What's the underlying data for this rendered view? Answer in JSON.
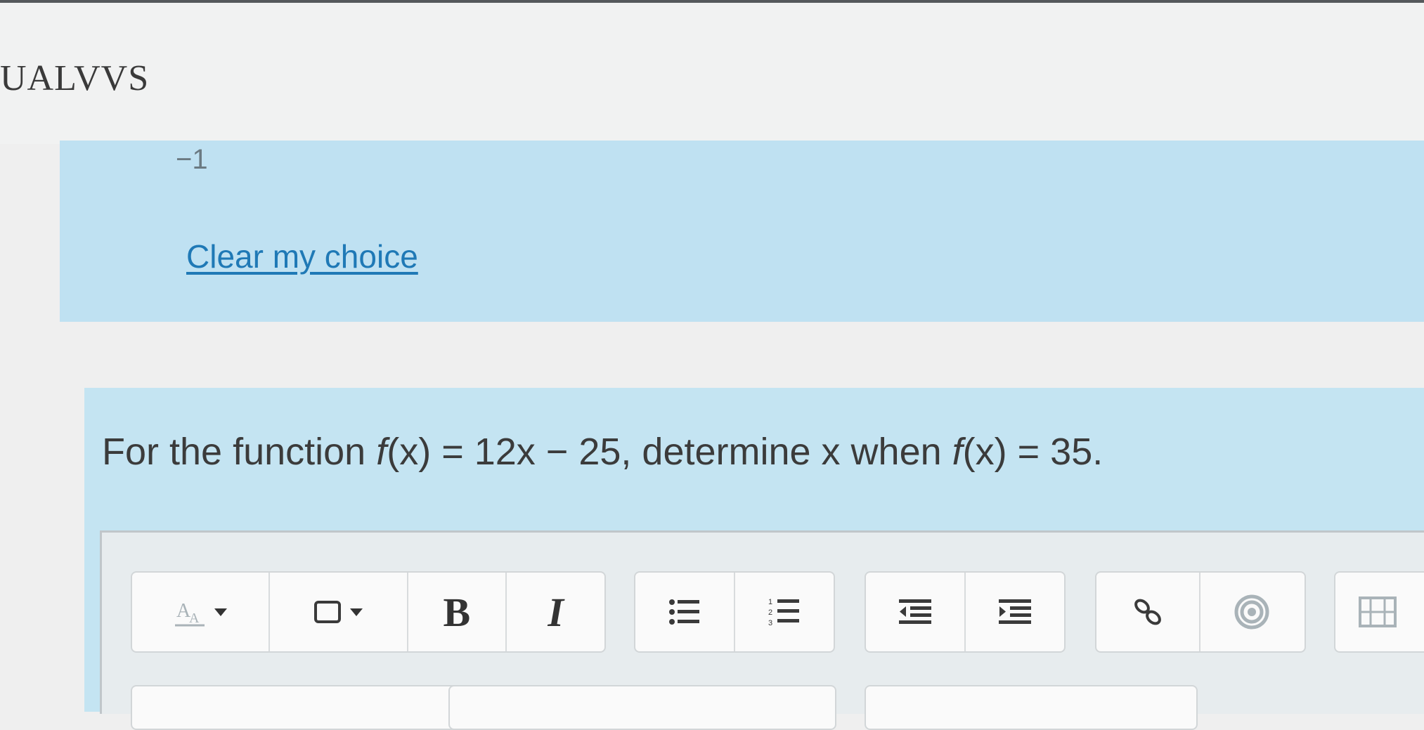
{
  "header": {
    "title": "UALVVS"
  },
  "answer": {
    "option_value": "−1",
    "clear_label": "Clear my choice"
  },
  "question": {
    "text_1": "For the function ",
    "f1": "f",
    "text_2": "(x) = 12x − 25, determine x when ",
    "f2": "f",
    "text_3": "(x) = 35."
  },
  "toolbar": {
    "font_style_icon": "font-size-icon",
    "paragraph_icon": "paragraph-format-icon",
    "bold_label": "B",
    "italic_label": "I",
    "bullet_icon": "unordered-list-icon",
    "numbered_icon": "ordered-list-icon",
    "outdent_icon": "outdent-icon",
    "indent_icon": "indent-icon",
    "link_icon": "link-icon",
    "unlink_icon": "unlink-icon",
    "media_icon": "media-icon",
    "colors": {
      "icon": "#3a3a3a",
      "disabled": "#a9b3b8"
    }
  }
}
